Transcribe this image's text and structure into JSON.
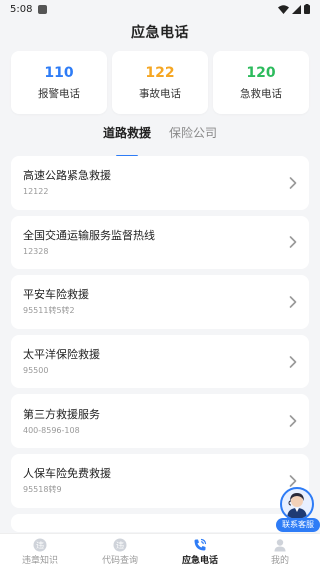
{
  "status_bar": {
    "time": "5:08"
  },
  "header": {
    "title": "应急电话"
  },
  "hotlines": [
    {
      "number": "110",
      "label": "报警电话",
      "color": "#2e7cf6"
    },
    {
      "number": "122",
      "label": "事故电话",
      "color": "#f5a623"
    },
    {
      "number": "120",
      "label": "急救电话",
      "color": "#2dbb5d"
    }
  ],
  "tabs": [
    {
      "label": "道路救援",
      "active": true
    },
    {
      "label": "保险公司",
      "active": false
    }
  ],
  "services": [
    {
      "title": "高速公路紧急救援",
      "phone": "12122"
    },
    {
      "title": "全国交通运输服务监督热线",
      "phone": "12328"
    },
    {
      "title": "平安车险救援",
      "phone": "95511转5转2"
    },
    {
      "title": "太平洋保险救援",
      "phone": "95500"
    },
    {
      "title": "第三方救援服务",
      "phone": "400-8596-108"
    },
    {
      "title": "人保车险免费救援",
      "phone": "95518转9"
    }
  ],
  "customer_service": {
    "label": "联系客服"
  },
  "bottom_nav": [
    {
      "label": "违章知识",
      "icon": "violation-icon",
      "active": false
    },
    {
      "label": "代码查询",
      "icon": "code-query-icon",
      "active": false
    },
    {
      "label": "应急电话",
      "icon": "phone-icon",
      "active": true
    },
    {
      "label": "我的",
      "icon": "profile-icon",
      "active": false
    }
  ],
  "colors": {
    "accent": "#2e7cf6",
    "background": "#f4f5f7"
  }
}
